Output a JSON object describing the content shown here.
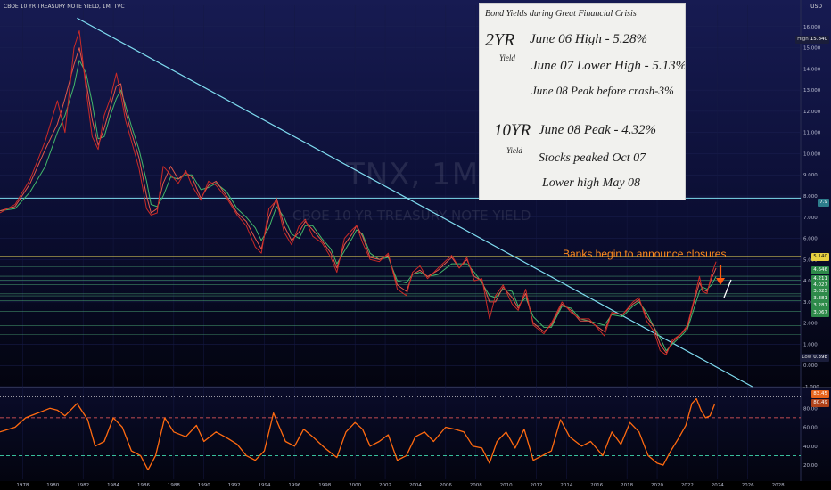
{
  "header": {
    "symbol_line": "CBOE 10 YR TREASURY NOTE YIELD, 1M, TVC",
    "currency": "USD"
  },
  "watermark": {
    "ticker": "TNX, 1M",
    "name": "CBOE 10 YR TREASURY NOTE YIELD"
  },
  "annotation": {
    "text": "Banks begin to announce closures",
    "color": "#ff8a1c"
  },
  "note": {
    "title": "Bond Yields during Great Financial Crisis",
    "label_2yr": "2YR",
    "yield_label_1": "Yield",
    "line1": "June 06 High - 5.28%",
    "line2": "June 07 Lower High - 5.13%",
    "line3": "June 08 Peak before crash-3%",
    "label_10yr": "10YR",
    "yield_label_2": "Yield",
    "line4": "June 08 Peak - 4.32%",
    "line5": "Stocks peaked Oct 07",
    "line6": "Lower high May 08"
  },
  "price_tags": {
    "high": {
      "key": "High",
      "value": "15.840"
    },
    "low": {
      "key": "Low",
      "value": "0.398"
    },
    "level_cyan": "7.9",
    "level_yellow": "5.140",
    "levels": [
      "4.646",
      "4.211",
      "4.027",
      "3.825",
      "3.381",
      "3.287",
      "3.067"
    ],
    "rsi_a": "83.45",
    "rsi_b": "80.49"
  },
  "chart_data": [
    {
      "type": "line",
      "title": "CBOE 10 YR TREASURY NOTE YIELD",
      "xlabel": "",
      "ylabel": "",
      "scale": "linear",
      "ylim": [
        -1,
        17
      ],
      "xlim": [
        1976.5,
        2029.5
      ],
      "y_ticks": [
        "16.000",
        "15.000",
        "14.000",
        "13.000",
        "12.000",
        "11.000",
        "10.000",
        "9.000",
        "8.000",
        "7.000",
        "6.000",
        "5.000",
        "4.000",
        "3.000",
        "2.000",
        "1.000",
        "0.000",
        "-1.000"
      ],
      "x_ticks": [
        "1978",
        "1980",
        "1982",
        "1984",
        "1986",
        "1988",
        "1990",
        "1992",
        "1994",
        "1996",
        "1998",
        "2000",
        "2002",
        "2004",
        "2006",
        "2008",
        "2010",
        "2012",
        "2014",
        "2016",
        "2018",
        "2020",
        "2022",
        "2024",
        "2026",
        "2028"
      ],
      "series": [
        {
          "color": "#43b86a",
          "x": [
            1976.5,
            1977.5,
            1978.5,
            1979.5,
            1980.3,
            1980.8,
            1981.4,
            1981.75,
            1982.2,
            1982.6,
            1983.0,
            1983.4,
            1983.8,
            1984.2,
            1984.5,
            1984.8,
            1985.2,
            1985.7,
            1986.2,
            1986.5,
            1986.9,
            1987.3,
            1987.8,
            1988.3,
            1988.8,
            1989.2,
            1989.8,
            1990.3,
            1990.8,
            1991.5,
            1992.2,
            1992.8,
            1993.4,
            1993.8,
            1994.3,
            1994.8,
            1995.3,
            1995.8,
            1996.3,
            1996.7,
            1997.2,
            1997.8,
            1998.4,
            1998.8,
            1999.3,
            1999.8,
            2000.1,
            2000.5,
            2001.0,
            2001.6,
            2002.2,
            2002.8,
            2003.4,
            2003.8,
            2004.3,
            2004.8,
            2005.5,
            2006.4,
            2006.9,
            2007.4,
            2007.9,
            2008.4,
            2008.9,
            2009.3,
            2009.8,
            2010.4,
            2010.8,
            2011.3,
            2011.8,
            2012.5,
            2013.0,
            2013.7,
            2014.3,
            2014.9,
            2015.5,
            2016.5,
            2017.0,
            2017.7,
            2018.4,
            2018.8,
            2019.3,
            2019.8,
            2020.2,
            2020.6,
            2021.0,
            2021.6,
            2022.0,
            2022.4,
            2022.8,
            2023.0,
            2023.3,
            2023.6,
            2023.9
          ],
          "y": [
            7.3,
            7.4,
            8.2,
            9.4,
            11.0,
            11.8,
            13.2,
            14.4,
            13.8,
            12.4,
            10.7,
            10.8,
            11.8,
            12.6,
            13.0,
            12.3,
            11.3,
            10.2,
            8.7,
            7.6,
            7.5,
            8.0,
            8.9,
            8.8,
            9.0,
            9.0,
            8.3,
            8.4,
            8.6,
            8.2,
            7.4,
            7.0,
            6.5,
            5.9,
            6.5,
            7.5,
            7.0,
            6.2,
            6.0,
            6.6,
            6.6,
            6.0,
            5.5,
            4.8,
            5.4,
            6.0,
            6.4,
            6.2,
            5.3,
            5.0,
            5.1,
            4.0,
            3.9,
            4.3,
            4.4,
            4.2,
            4.3,
            4.8,
            4.8,
            4.8,
            4.4,
            3.9,
            3.3,
            3.2,
            3.6,
            3.5,
            2.8,
            3.2,
            2.3,
            1.8,
            1.8,
            2.8,
            2.7,
            2.2,
            2.1,
            1.9,
            2.4,
            2.3,
            2.8,
            3.0,
            2.5,
            1.8,
            1.3,
            0.7,
            1.0,
            1.4,
            1.7,
            2.6,
            3.5,
            3.7,
            3.6,
            3.8,
            4.2
          ]
        },
        {
          "color": "#e1584a",
          "x": [
            1976.5,
            1977.5,
            1978.5,
            1979.5,
            1980.3,
            1980.8,
            1981.4,
            1981.75,
            1982.2,
            1982.6,
            1983.0,
            1983.4,
            1983.8,
            1984.2,
            1984.5,
            1984.8,
            1985.2,
            1985.7,
            1986.2,
            1986.5,
            1986.9,
            1987.3,
            1987.8,
            1988.3,
            1988.8,
            1989.2,
            1989.8,
            1990.3,
            1990.8,
            1991.5,
            1992.2,
            1992.8,
            1993.4,
            1993.8,
            1994.3,
            1994.8,
            1995.3,
            1995.8,
            1996.3,
            1996.7,
            1997.2,
            1997.8,
            1998.4,
            1998.8,
            1999.3,
            1999.8,
            2000.1,
            2000.5,
            2001.0,
            2001.6,
            2002.2,
            2002.8,
            2003.4,
            2003.8,
            2004.3,
            2004.8,
            2005.5,
            2006.4,
            2006.9,
            2007.4,
            2007.9,
            2008.4,
            2008.9,
            2009.3,
            2009.8,
            2010.4,
            2010.8,
            2011.3,
            2011.8,
            2012.5,
            2013.0,
            2013.7,
            2014.3,
            2014.9,
            2015.5,
            2016.5,
            2017.0,
            2017.7,
            2018.4,
            2018.8,
            2019.3,
            2019.8,
            2020.2,
            2020.6,
            2021.0,
            2021.6,
            2022.0,
            2022.4,
            2022.8,
            2023.0,
            2023.3,
            2023.6,
            2023.9
          ],
          "y": [
            7.3,
            7.5,
            8.6,
            10.2,
            11.4,
            12.6,
            14.2,
            15.0,
            13.4,
            11.6,
            10.4,
            11.2,
            12.2,
            13.2,
            13.3,
            12.0,
            11.0,
            9.8,
            8.0,
            7.2,
            7.4,
            8.6,
            9.4,
            8.8,
            9.1,
            8.9,
            7.9,
            8.5,
            8.7,
            8.0,
            7.2,
            6.8,
            6.0,
            5.5,
            7.0,
            7.9,
            6.6,
            5.9,
            6.3,
            6.8,
            6.4,
            5.9,
            5.3,
            4.6,
            5.7,
            6.2,
            6.6,
            6.1,
            5.1,
            5.0,
            5.2,
            3.8,
            3.5,
            4.3,
            4.5,
            4.2,
            4.5,
            5.1,
            4.6,
            5.0,
            4.2,
            4.0,
            3.0,
            3.0,
            3.7,
            3.2,
            2.7,
            3.4,
            2.0,
            1.6,
            1.9,
            2.9,
            2.6,
            2.1,
            2.1,
            1.6,
            2.5,
            2.4,
            2.9,
            3.1,
            2.3,
            1.8,
            1.0,
            0.6,
            1.1,
            1.5,
            1.8,
            2.9,
            3.9,
            3.6,
            3.5,
            4.1,
            4.6
          ]
        },
        {
          "color": "#cc2a26",
          "x": [
            1976.5,
            1977.5,
            1978.5,
            1979.5,
            1980.3,
            1980.8,
            1981.4,
            1981.75,
            1982.2,
            1982.6,
            1983.0,
            1983.4,
            1983.8,
            1984.2,
            1984.5,
            1984.8,
            1985.2,
            1985.7,
            1986.2,
            1986.5,
            1986.9,
            1987.3,
            1987.8,
            1988.3,
            1988.8,
            1989.2,
            1989.8,
            1990.3,
            1990.8,
            1991.5,
            1992.2,
            1992.8,
            1993.4,
            1993.8,
            1994.3,
            1994.8,
            1995.3,
            1995.8,
            1996.3,
            1996.7,
            1997.2,
            1997.8,
            1998.4,
            1998.8,
            1999.3,
            1999.8,
            2000.1,
            2000.5,
            2001.0,
            2001.6,
            2002.2,
            2002.8,
            2003.4,
            2003.8,
            2004.3,
            2004.8,
            2005.5,
            2006.4,
            2006.9,
            2007.4,
            2007.9,
            2008.4,
            2008.9,
            2009.3,
            2009.8,
            2010.4,
            2010.8,
            2011.3,
            2011.8,
            2012.5,
            2013.0,
            2013.7,
            2014.3,
            2014.9,
            2015.5,
            2016.5,
            2017.0,
            2017.7,
            2018.4,
            2018.8,
            2019.3,
            2019.8,
            2020.2,
            2020.6,
            2021.0,
            2021.6,
            2022.0,
            2022.4,
            2022.8,
            2023.0,
            2023.3,
            2023.6,
            2023.9
          ],
          "y": [
            7.2,
            7.6,
            8.8,
            10.6,
            12.5,
            11.0,
            15.0,
            15.8,
            13.0,
            10.8,
            10.2,
            11.8,
            12.6,
            13.8,
            12.8,
            11.6,
            10.6,
            9.3,
            7.4,
            7.1,
            7.2,
            9.4,
            9.0,
            8.6,
            9.2,
            8.5,
            7.8,
            8.7,
            8.5,
            7.9,
            7.1,
            6.6,
            5.6,
            5.3,
            7.4,
            7.8,
            6.3,
            5.7,
            6.6,
            6.9,
            6.1,
            5.8,
            5.1,
            4.4,
            6.0,
            6.4,
            6.6,
            5.8,
            5.0,
            4.9,
            5.3,
            3.6,
            3.3,
            4.4,
            4.7,
            4.1,
            4.6,
            5.2,
            4.6,
            5.1,
            4.0,
            4.1,
            2.2,
            3.3,
            3.8,
            2.9,
            2.6,
            3.6,
            1.9,
            1.5,
            2.0,
            3.0,
            2.5,
            2.2,
            2.2,
            1.4,
            2.5,
            2.4,
            3.0,
            3.2,
            2.1,
            1.6,
            0.7,
            0.5,
            1.2,
            1.5,
            1.9,
            3.0,
            4.2,
            3.5,
            3.4,
            4.3,
            4.9
          ]
        }
      ],
      "horizontal_levels": [
        {
          "value": 7.9,
          "color": "#7fdcf0"
        },
        {
          "value": 5.14,
          "color": "#f3e05a"
        },
        {
          "value": 4.646,
          "color": "#4fb07a"
        },
        {
          "value": 4.211,
          "color": "#4fb07a"
        },
        {
          "value": 4.027,
          "color": "#4fb07a"
        },
        {
          "value": 3.825,
          "color": "#4fb07a"
        },
        {
          "value": 3.381,
          "color": "#4fb07a"
        },
        {
          "value": 3.287,
          "color": "#4fb07a"
        },
        {
          "value": 3.067,
          "color": "#4fb07a"
        },
        {
          "value": 2.55,
          "color": "#4fb07a"
        },
        {
          "value": 1.88,
          "color": "#4fb07a"
        },
        {
          "value": 1.45,
          "color": "#4fb07a"
        }
      ],
      "trendline": {
        "x": [
          1981.6,
          2026.3
        ],
        "y": [
          16.4,
          -1.0
        ],
        "color": "#7fdcf0"
      }
    },
    {
      "type": "line",
      "title": "",
      "ylim": [
        5,
        100
      ],
      "y_ticks": [
        "80.00",
        "60.00",
        "40.00",
        "20.00"
      ],
      "reference_levels": [
        70,
        30
      ],
      "series": [
        {
          "color": "#ff6a10",
          "x": [
            1976.5,
            1977.5,
            1978.2,
            1979.0,
            1979.8,
            1980.3,
            1980.8,
            1981.6,
            1982.3,
            1982.8,
            1983.4,
            1984.0,
            1984.6,
            1985.2,
            1985.8,
            1986.3,
            1986.8,
            1987.4,
            1988.0,
            1988.8,
            1989.5,
            1990.0,
            1990.8,
            1991.6,
            1992.2,
            1992.8,
            1993.4,
            1994.0,
            1994.6,
            1995.4,
            1996.0,
            1996.6,
            1997.2,
            1998.0,
            1998.8,
            1999.4,
            2000.0,
            2000.5,
            2001.0,
            2001.6,
            2002.2,
            2002.8,
            2003.4,
            2004.0,
            2004.6,
            2005.2,
            2006.0,
            2006.6,
            2007.2,
            2007.8,
            2008.4,
            2008.9,
            2009.4,
            2010.0,
            2010.6,
            2011.2,
            2011.8,
            2012.4,
            2013.0,
            2013.6,
            2014.2,
            2015.0,
            2015.6,
            2016.4,
            2017.0,
            2017.6,
            2018.2,
            2018.8,
            2019.4,
            2020.0,
            2020.4,
            2020.9,
            2021.4,
            2021.9,
            2022.3,
            2022.6,
            2022.9,
            2023.2,
            2023.5,
            2023.8
          ],
          "y": [
            55,
            60,
            70,
            75,
            80,
            78,
            72,
            85,
            68,
            40,
            45,
            70,
            60,
            35,
            30,
            15,
            30,
            70,
            55,
            50,
            62,
            45,
            55,
            48,
            42,
            30,
            25,
            35,
            75,
            45,
            40,
            58,
            50,
            38,
            28,
            55,
            65,
            58,
            40,
            45,
            52,
            25,
            30,
            50,
            55,
            45,
            60,
            58,
            55,
            40,
            38,
            22,
            45,
            55,
            38,
            58,
            25,
            30,
            35,
            68,
            50,
            40,
            45,
            30,
            55,
            42,
            65,
            55,
            30,
            22,
            20,
            35,
            48,
            62,
            85,
            90,
            78,
            70,
            72,
            84
          ]
        }
      ]
    }
  ]
}
